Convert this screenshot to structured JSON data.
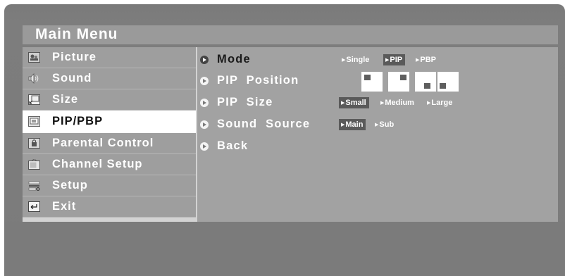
{
  "menu": {
    "title": "Main Menu"
  },
  "sidebar": {
    "items": [
      {
        "label": "Picture",
        "icon": "picture-icon",
        "selected": false
      },
      {
        "label": "Sound",
        "icon": "speaker-icon",
        "selected": false
      },
      {
        "label": "Size",
        "icon": "resize-icon",
        "selected": false
      },
      {
        "label": "PIP/PBP",
        "icon": "pip-icon",
        "selected": true
      },
      {
        "label": "Parental  Control",
        "icon": "parental-lock-icon",
        "selected": false
      },
      {
        "label": "Channel  Setup",
        "icon": "tv-channel-icon",
        "selected": false
      },
      {
        "label": "Setup",
        "icon": "setup-tools-icon",
        "selected": false
      },
      {
        "label": "Exit",
        "icon": "exit-return-icon",
        "selected": false
      }
    ]
  },
  "options": [
    {
      "label": "Mode",
      "active": true
    },
    {
      "label": "PIP  Position",
      "active": false
    },
    {
      "label": "PIP  Size",
      "active": false
    },
    {
      "label": "Sound  Source",
      "active": false
    },
    {
      "label": "Back",
      "active": false
    }
  ],
  "mode_choices": [
    "Single",
    "PIP",
    "PBP"
  ],
  "mode_selected": "PIP",
  "pip_positions": [
    "top-left",
    "top-right",
    "bottom-left",
    "bottom-right"
  ],
  "size_choices": [
    "Small",
    "Medium",
    "Large"
  ],
  "size_selected": "Small",
  "sound_source_choices": [
    "Main",
    "Sub"
  ],
  "sound_source_selected": "Main",
  "colors": {
    "selected_row": "#ffffff",
    "sidebar": "#9e9e9e",
    "content": "#a2a2a2",
    "frame": "#7b7b7b"
  }
}
